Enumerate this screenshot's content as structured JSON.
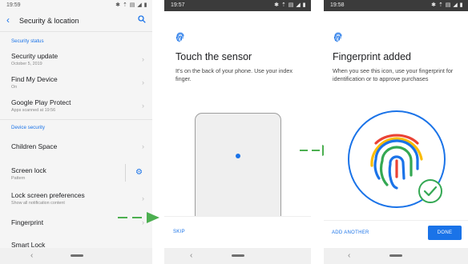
{
  "screen1": {
    "status": {
      "time": "19:59",
      "icons": "✱ ⇡ ▤ ◢ ▮"
    },
    "title": "Security & location",
    "sections": {
      "security_status": "Security status",
      "device_security": "Device security"
    },
    "items": [
      {
        "title": "Security update",
        "subtitle": "October 5, 2019"
      },
      {
        "title": "Find My Device",
        "subtitle": "On"
      },
      {
        "title": "Google Play Protect",
        "subtitle": "Apps scanned at 19:56"
      },
      {
        "title": "Children Space",
        "subtitle": ""
      },
      {
        "title": "Screen lock",
        "subtitle": "Pattern"
      },
      {
        "title": "Lock screen preferences",
        "subtitle": "Show all notification content"
      },
      {
        "title": "Fingerprint",
        "subtitle": ""
      },
      {
        "title": "Smart Lock",
        "subtitle": ""
      }
    ]
  },
  "screen2": {
    "status": {
      "time": "19:57",
      "icons": "✱ ⇡ ▤ ◢ ▮"
    },
    "heading": "Touch the sensor",
    "body": "It's on the back of your phone. Use your index finger.",
    "skip_label": "SKIP"
  },
  "screen3": {
    "status": {
      "time": "19:58",
      "icons": "✱ ⇡ ▤ ◢ ▮"
    },
    "heading": "Fingerprint added",
    "body": "When you see this icon, use your fingerprint for identification or to approve purchases",
    "add_another_label": "ADD ANOTHER",
    "done_label": "DONE"
  },
  "colors": {
    "accent": "#1a73e8",
    "arrow": "#4caf50",
    "check": "#34a853"
  },
  "icons": [
    "back-arrow-icon",
    "search-icon",
    "chevron-right-icon",
    "gear-icon",
    "fingerprint-icon",
    "check-icon"
  ]
}
